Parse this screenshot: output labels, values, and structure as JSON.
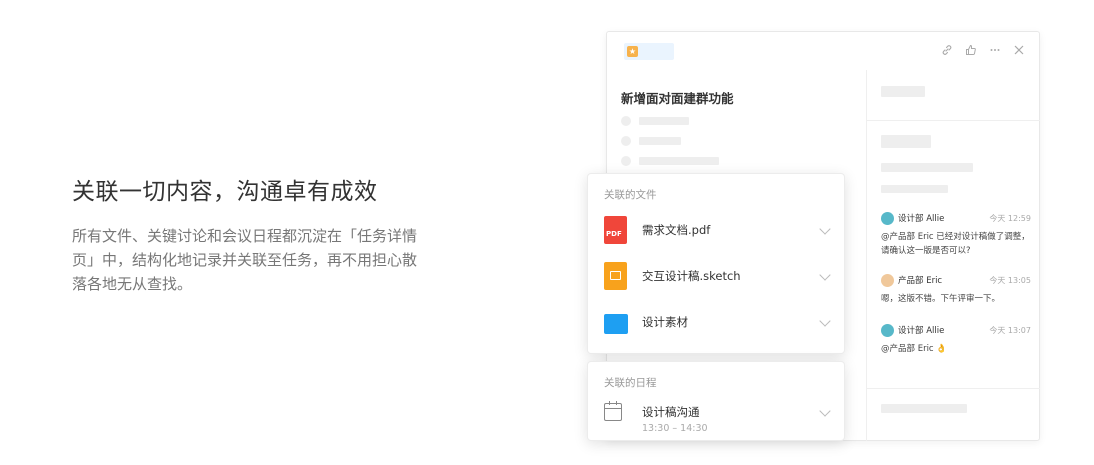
{
  "hero": {
    "title": "关联一切内容，沟通卓有成效",
    "description": "所有文件、关键讨论和会议日程都沉淀在「任务详情页」中，结构化地记录并关联至任务，再不用担心散落各地无从查找。"
  },
  "task": {
    "title": "新增面对面建群功能",
    "header_icons": [
      "link-icon",
      "thumbs-up-icon",
      "more-icon",
      "close-icon"
    ]
  },
  "comments": [
    {
      "author": "设计部 Allie",
      "time": "今天 12:59",
      "text": "@产品部 Eric 已经对设计稿做了调整，请确认这一版是否可以?"
    },
    {
      "author": "产品部 Eric",
      "time": "今天 13:05",
      "text": "嗯，这版不错。下午评审一下。"
    },
    {
      "author": "设计部 Allie",
      "time": "今天 13:07",
      "text": "@产品部 Eric 👌"
    }
  ],
  "files": {
    "label": "关联的文件",
    "items": [
      {
        "name": "需求文档.pdf",
        "type": "pdf"
      },
      {
        "name": "交互设计稿.sketch",
        "type": "sketch"
      },
      {
        "name": "设计素材",
        "type": "folder"
      }
    ],
    "pdf_badge": "PDF"
  },
  "schedule": {
    "label": "关联的日程",
    "title": "设计稿沟通",
    "time": "13:30 – 14:30"
  }
}
